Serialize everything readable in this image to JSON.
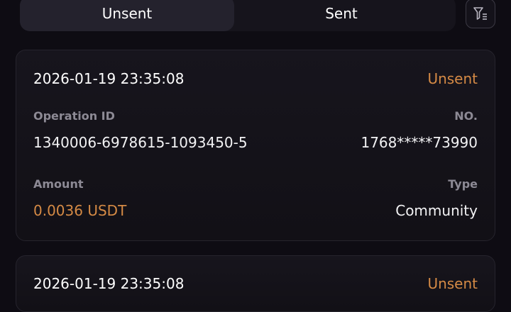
{
  "tabs": {
    "unsent": "Unsent",
    "sent": "Sent"
  },
  "filter": {
    "icon": "filter-icon"
  },
  "records": [
    {
      "datetime": "2026-01-19 23:35:08",
      "status": "Unsent",
      "operation_id_label": "Operation ID",
      "operation_id": "1340006-6978615-1093450-5",
      "no_label": "NO.",
      "no": "1768*****73990",
      "amount_label": "Amount",
      "amount": "0.0036 USDT",
      "type_label": "Type",
      "type": "Community"
    },
    {
      "datetime": "2026-01-19 23:35:08",
      "status": "Unsent"
    }
  ],
  "colors": {
    "background": "#0e0c13",
    "accent": "#d58a45",
    "card": "#17151d"
  }
}
